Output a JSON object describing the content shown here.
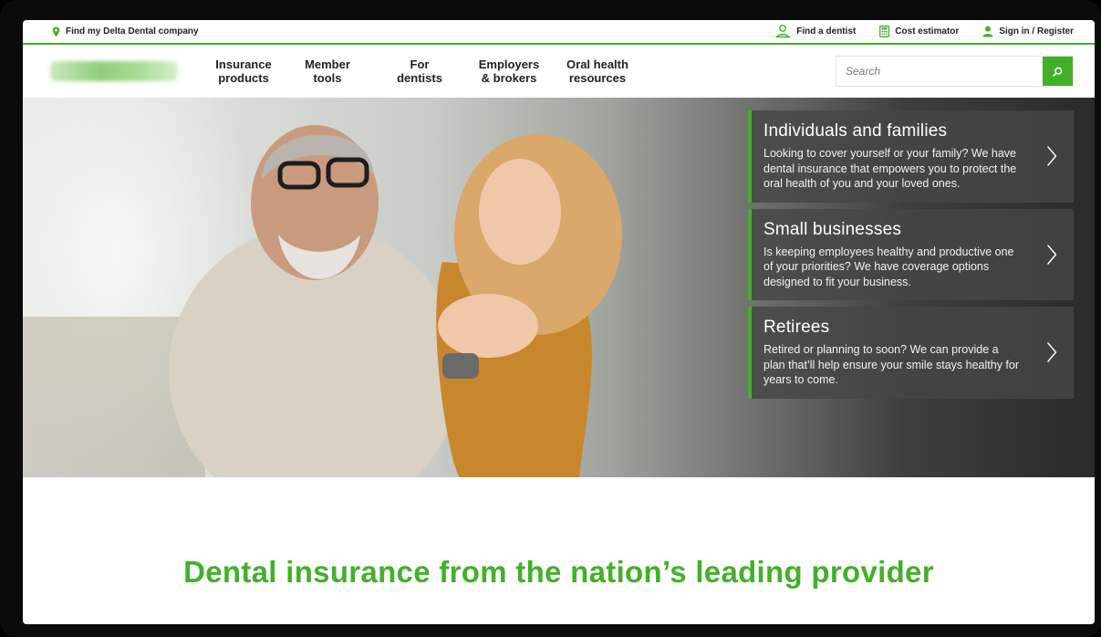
{
  "utility": {
    "find_company": "Find my Delta Dental company",
    "find_dentist": "Find a dentist",
    "cost_estimator": "Cost estimator",
    "sign_in": "Sign in / Register"
  },
  "nav": {
    "items": [
      {
        "line1": "Insurance",
        "line2": "products"
      },
      {
        "line1": "Member",
        "line2": "tools"
      },
      {
        "line1": "For",
        "line2": "dentists"
      },
      {
        "line1": "Employers",
        "line2": "& brokers"
      },
      {
        "line1": "Oral health",
        "line2": "resources"
      }
    ],
    "search_placeholder": "Search"
  },
  "panels": [
    {
      "title": "Individuals and families",
      "text": "Looking to cover yourself or your family? We have dental insurance that empowers you to protect the oral health of you and your loved ones."
    },
    {
      "title": "Small businesses",
      "text": "Is keeping employees healthy and productive one of your priorities? We have coverage options designed to fit your business."
    },
    {
      "title": "Retirees",
      "text": "Retired or planning to soon? We can provide a plan that’ll help ensure your smile stays healthy for years to come."
    }
  ],
  "tagline": "Dental insurance from the nation’s leading provider",
  "colors": {
    "accent": "#43b02a"
  },
  "icons": {
    "find_company": "location-pin-icon",
    "find_dentist": "dentist-person-icon",
    "cost_estimator": "calculator-icon",
    "sign_in": "user-icon",
    "search": "search-icon",
    "panel_arrow": "chevron-right-icon"
  }
}
